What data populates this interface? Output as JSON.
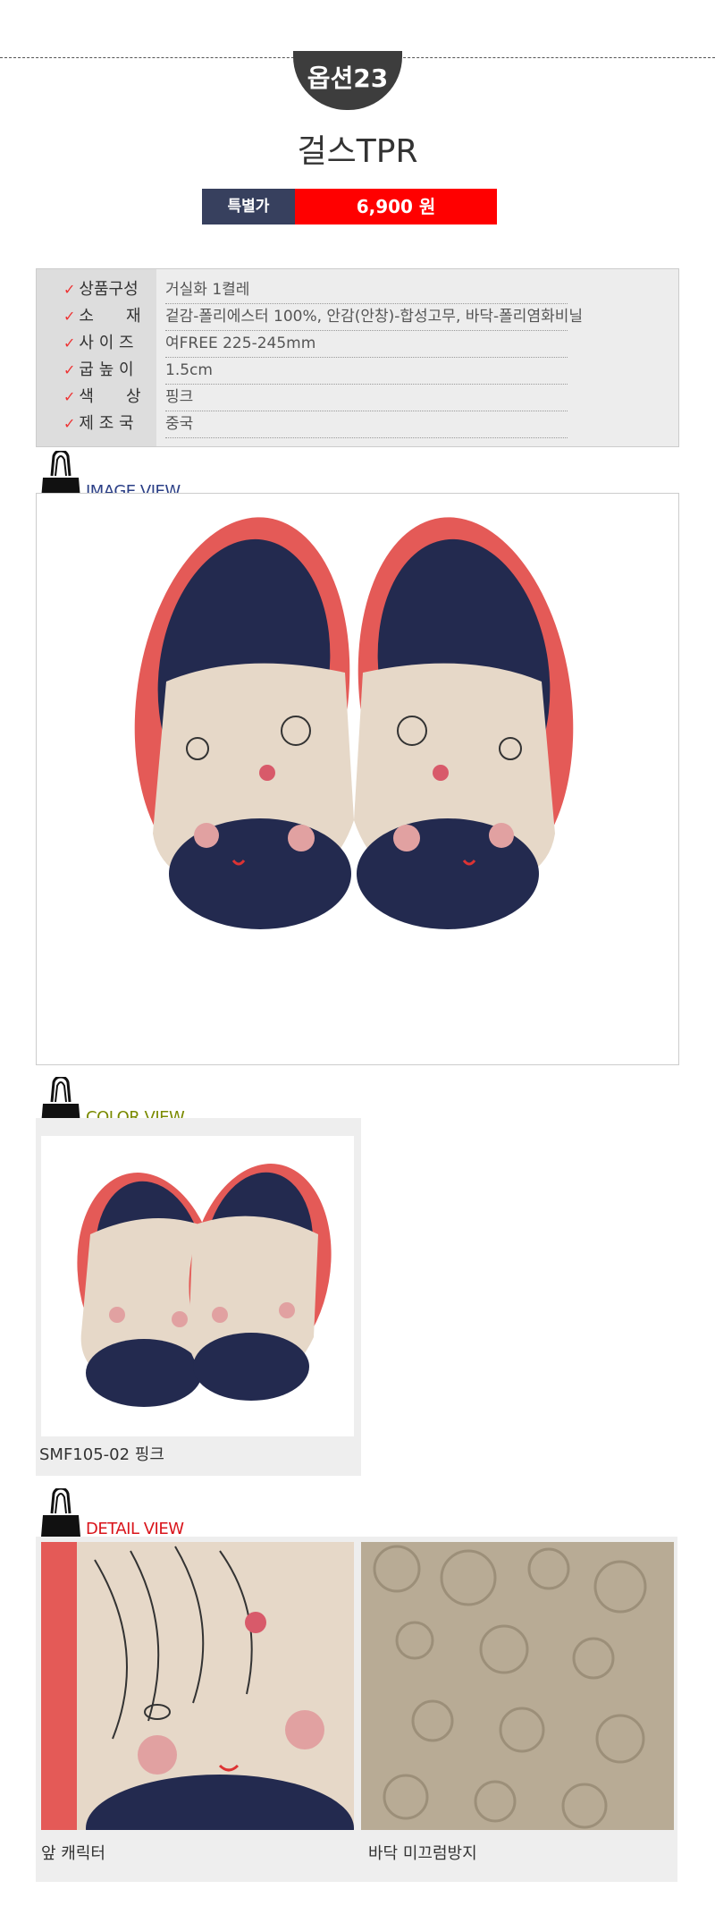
{
  "header": {
    "option_badge": "옵션23",
    "product_name": "걸스TPR",
    "price_label": "특별가",
    "price": "6,900 원"
  },
  "spec": {
    "rows": [
      {
        "label": "상품구성",
        "value": "거실화 1켤레"
      },
      {
        "label": "소　　재",
        "value": "겉감-폴리에스터 100%, 안감(안창)-합성고무, 바닥-폴리염화비닐"
      },
      {
        "label": "사 이 즈",
        "value": "여FREE 225-245mm"
      },
      {
        "label": "굽 높 이",
        "value": "1.5cm"
      },
      {
        "label": "색　　상",
        "value": "핑크"
      },
      {
        "label": "제 조 국",
        "value": "중국"
      }
    ],
    "check_mark": "✓"
  },
  "sections": {
    "image_view": {
      "title": "IMAGE VIEW",
      "color": "#2b3f86"
    },
    "color_view": {
      "title": "COLOR VIEW",
      "color": "#7a8a00",
      "caption": "SMF105-02 핑크"
    },
    "detail_view": {
      "title": "DETAIL VIEW",
      "color": "#d9141b",
      "captions": [
        "앞 캐릭터",
        "바닥 미끄럼방지"
      ]
    }
  },
  "colors": {
    "price_label_bg": "#37405e",
    "price_bg": "#ff0000",
    "badge_bg": "#3d3d3d",
    "slipper_rim": "#e45a57",
    "slipper_inner": "#232a4f",
    "slipper_top": "#e6d8c8"
  }
}
